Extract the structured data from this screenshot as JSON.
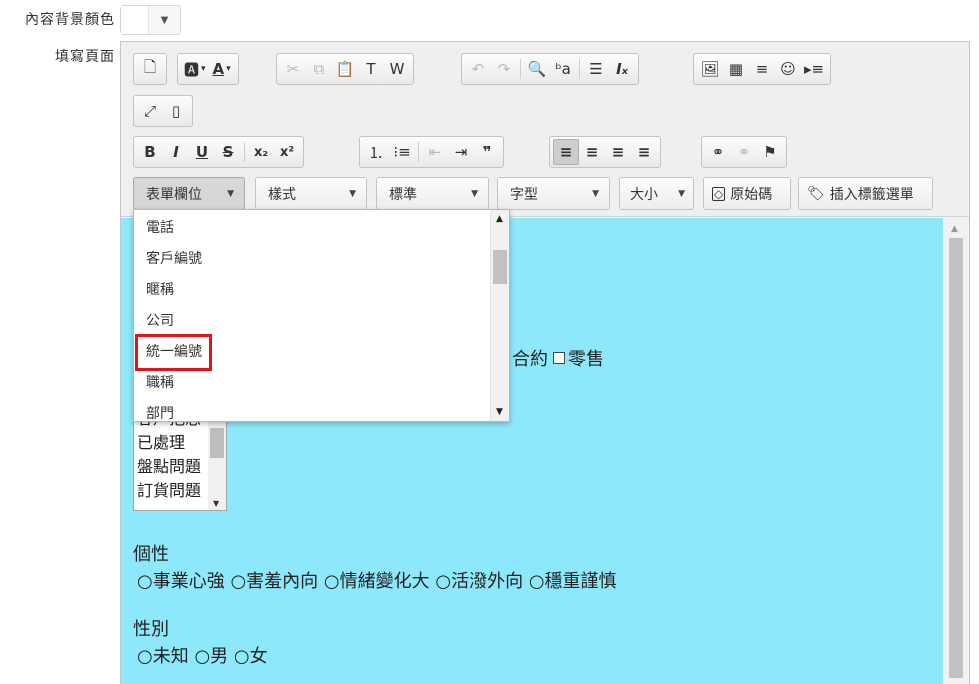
{
  "labels": {
    "content_bg_color": "內容背景顏色",
    "fill_page": "填寫頁面"
  },
  "bg_color_picker": {
    "arrow": "▼"
  },
  "toolbar": {
    "row1": {
      "preview": "🗋",
      "bgcolor": "🅰",
      "textcolor": "A",
      "cut": "✂",
      "copy": "⧉",
      "paste": "📋",
      "paste_text": "T",
      "paste_word": "W",
      "undo": "↶",
      "redo": "↷",
      "find": "🔍",
      "replace": "ᵇa",
      "select_all": "☰",
      "remove_format": "Iₓ",
      "image": "🖼",
      "table": "▦",
      "hline": "≡",
      "smiley": "☺",
      "pagebreak": "▸≡"
    },
    "row2": {
      "maximize": "⤢",
      "show_blocks": "▯"
    },
    "row3": {
      "bold": "B",
      "italic": "I",
      "underline": "U",
      "strike": "S",
      "subscript": "x₂",
      "superscript": "x²",
      "numbered_list": "⒈",
      "bulleted_list": "⁝≡",
      "outdent": "⇤",
      "indent": "⇥",
      "blockquote": "❞",
      "align_left": "≡",
      "align_center": "≡",
      "align_right": "≡",
      "justify": "≡",
      "link": "⚭",
      "unlink": "⚭",
      "anchor": "⚑"
    },
    "combos": {
      "form_field": "表單欄位",
      "style": "樣式",
      "format": "標準",
      "font": "字型",
      "size": "大小"
    },
    "source_button": "原始碼",
    "insert_tag_button": "插入標籤選單"
  },
  "dropdown": {
    "items": [
      "電話",
      "客戶編號",
      "暱稱",
      "公司",
      "統一編號",
      "職稱",
      "部門"
    ],
    "highlighted_item": "統一編號"
  },
  "content": {
    "checkbox_row": {
      "tail_text": "合約",
      "last_option": "零售"
    },
    "listbox_items": [
      "客戶抱怨",
      "已處理",
      "盤點問題",
      "訂貨問題"
    ],
    "personality": {
      "label": "個性",
      "options": [
        "事業心強",
        "害羞內向",
        "情緒變化大",
        "活潑外向",
        "穩重謹慎"
      ]
    },
    "gender": {
      "label": "性別",
      "options": [
        "未知",
        "男",
        "女"
      ]
    }
  },
  "colors": {
    "content_bg": "#8ee8fb",
    "highlight_border": "#e0141d"
  }
}
